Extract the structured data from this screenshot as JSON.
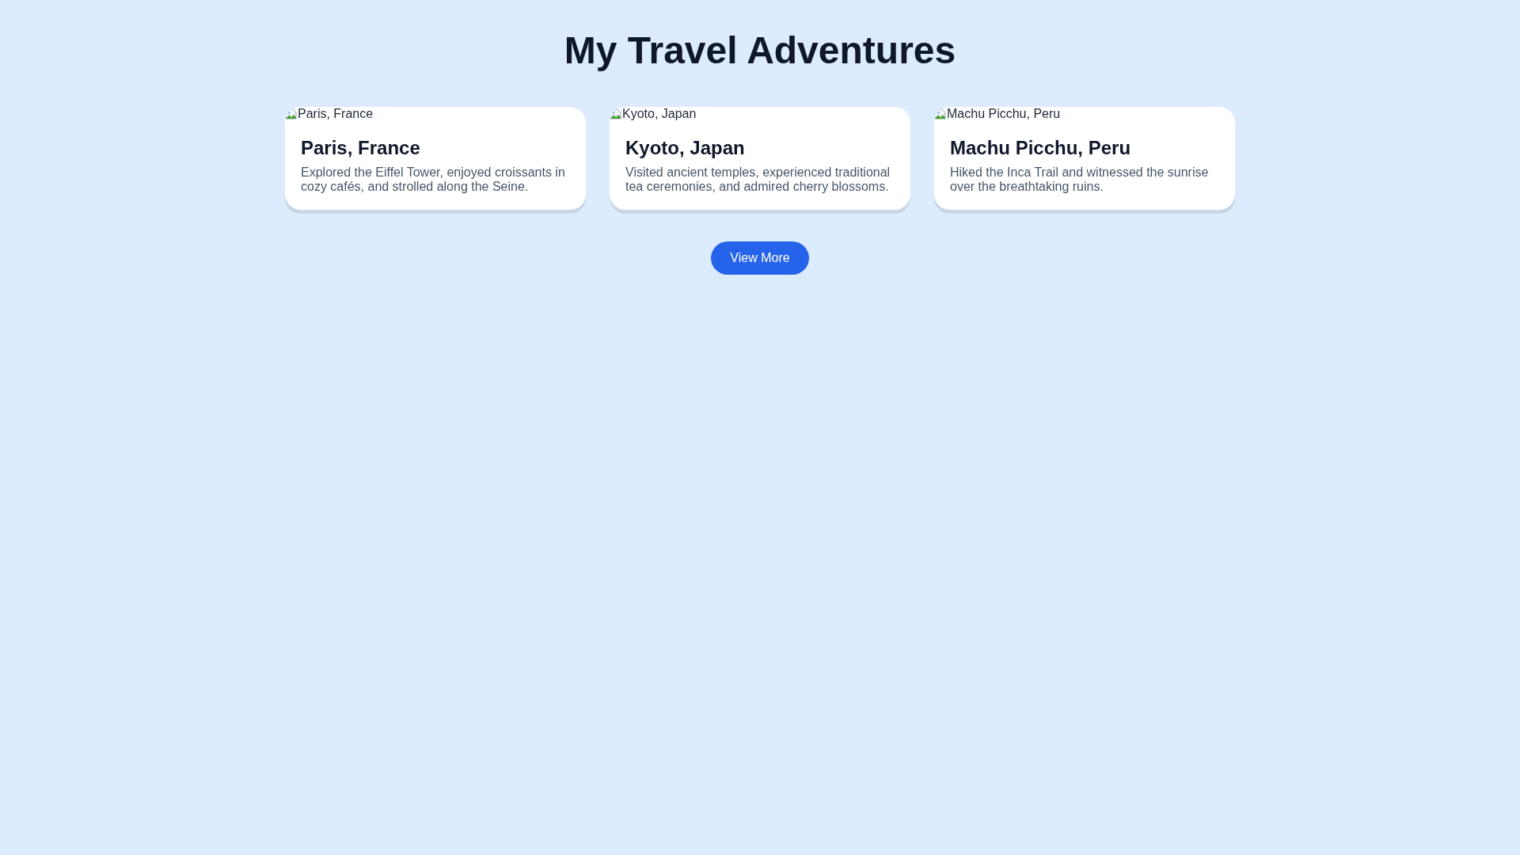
{
  "page": {
    "title": "My Travel Adventures"
  },
  "cards": [
    {
      "image_alt": "Paris, France",
      "title": "Paris, France",
      "description": "Explored the Eiffel Tower, enjoyed croissants in cozy cafés, and strolled along the Seine."
    },
    {
      "image_alt": "Kyoto, Japan",
      "title": "Kyoto, Japan",
      "description": "Visited ancient temples, experienced traditional tea ceremonies, and admired cherry blossoms."
    },
    {
      "image_alt": "Machu Picchu, Peru",
      "title": "Machu Picchu, Peru",
      "description": "Hiked the Inca Trail and witnessed the sunrise over the breathtaking ruins."
    }
  ],
  "button": {
    "label": "View More"
  }
}
